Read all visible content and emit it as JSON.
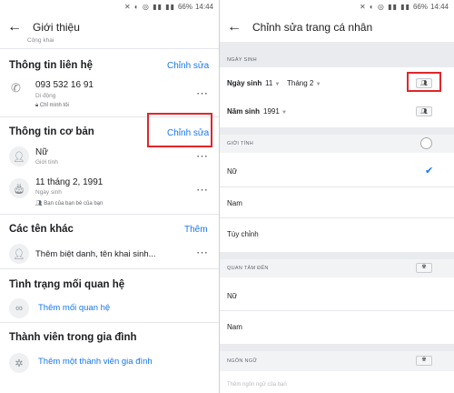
{
  "status": {
    "icons": "✕ ◐ ◎ ▮▮ ▮▮",
    "battery": "66%",
    "time": "14:44"
  },
  "left": {
    "title": "Giới thiệu",
    "top_partial": "Công khai",
    "contact": {
      "title": "Thông tin liên hệ",
      "edit": "Chỉnh sửa",
      "phone": "093 532 16 91",
      "phone_caption": "Di động",
      "privacy": "Chỉ mình tôi"
    },
    "basic": {
      "title": "Thông tin cơ bản",
      "edit": "Chỉnh sửa",
      "gender": "Nữ",
      "gender_caption": "Giới tính",
      "birthday": "11 tháng 2, 1991",
      "birthday_caption": "Ngày sinh",
      "birthday_privacy": "Bạn của bạn bè của bạn"
    },
    "other_names": {
      "title": "Các tên khác",
      "add": "Thêm",
      "placeholder": "Thêm biệt danh, tên khai sinh..."
    },
    "relationship": {
      "title": "Tình trạng mối quan hệ",
      "add": "Thêm mối quan hệ"
    },
    "family": {
      "title": "Thành viên trong gia đình",
      "add": "Thêm một thành viên gia đình"
    }
  },
  "right": {
    "title": "Chỉnh sửa trang cá nhân",
    "birthday_section": "NGÀY SINH",
    "birthday_label": "Ngày sinh",
    "day": "11",
    "month": "Tháng 2",
    "year_label": "Năm sinh",
    "year": "1991",
    "gender_section": "GIỚI TÍNH",
    "gender_options": [
      "Nữ",
      "Nam",
      "Tùy chỉnh"
    ],
    "interested_section": "QUAN TÂM ĐẾN",
    "interested_options": [
      "Nữ",
      "Nam"
    ],
    "language_section": "NGÔN NGỮ",
    "language_partial": "Thêm ngôn ngữ của bạn"
  },
  "colors": {
    "accent": "#1877f2",
    "highlight": "#e0262b",
    "band": "#e9ebee"
  }
}
